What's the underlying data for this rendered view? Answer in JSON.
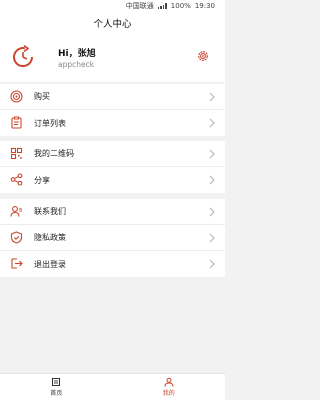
{
  "status_bar": {
    "carrier": "中国联通",
    "battery": "100%",
    "time": "19:30"
  },
  "page_title": "个人中心",
  "profile": {
    "greeting": "Hi，张旭",
    "subtitle": "appcheck"
  },
  "menu": [
    {
      "label": "购买",
      "icon": "purchase-icon"
    },
    {
      "label": "订单列表",
      "icon": "order-list-icon"
    },
    {
      "label": "我的二维码",
      "icon": "qr-code-icon"
    },
    {
      "label": "分享",
      "icon": "share-icon"
    },
    {
      "label": "联系我们",
      "icon": "contact-icon"
    },
    {
      "label": "隐私政策",
      "icon": "privacy-shield-icon"
    },
    {
      "label": "退出登录",
      "icon": "logout-icon"
    }
  ],
  "tabs": [
    {
      "label": "首页",
      "icon": "home-icon",
      "active": false
    },
    {
      "label": "我的",
      "icon": "profile-icon",
      "active": true
    }
  ],
  "colors": {
    "accent": "#c8482e",
    "background": "#f2f2f2",
    "card": "#ffffff"
  }
}
